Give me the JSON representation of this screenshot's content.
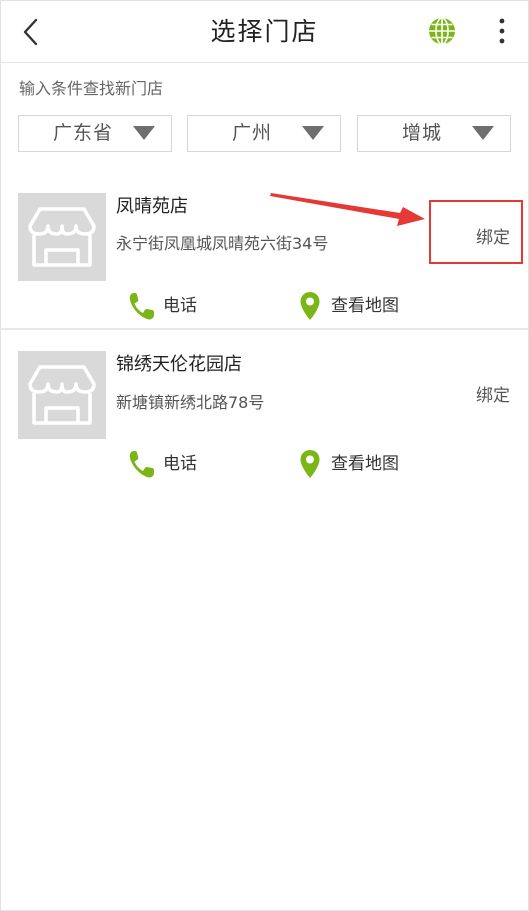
{
  "header": {
    "title": "选择门店",
    "back_icon": "chevron-left-icon",
    "globe_icon": "globe-icon",
    "more_icon": "more-vertical-icon"
  },
  "filter": {
    "hint": "输入条件查找新门店",
    "province": "广东省",
    "city": "广州",
    "district": "增城"
  },
  "stores": [
    {
      "name": "凤晴苑店",
      "address": "永宁街凤凰城凤晴苑六街34号",
      "bind_label": "绑定",
      "phone_label": "电话",
      "map_label": "查看地图"
    },
    {
      "name": "锦绣天伦花园店",
      "address": "新塘镇新绣北路78号",
      "bind_label": "绑定",
      "phone_label": "电话",
      "map_label": "查看地图"
    }
  ],
  "colors": {
    "accent_green": "#7cb518",
    "annotation_red": "#e53935",
    "thumb_gray": "#d9d9d9"
  }
}
